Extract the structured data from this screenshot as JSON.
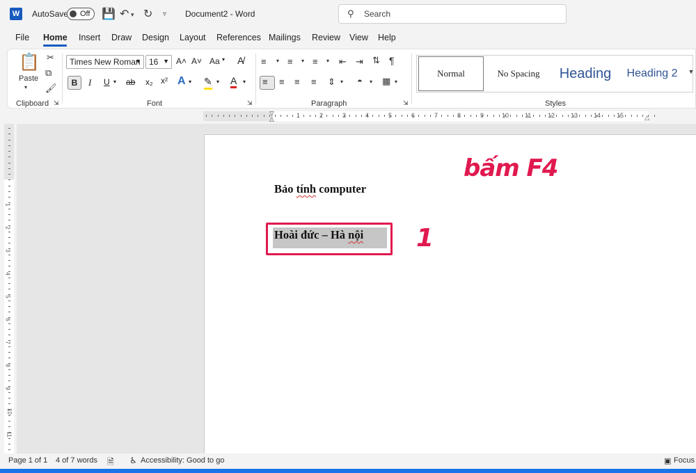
{
  "titlebar": {
    "logo": "W",
    "autosave_label": "AutoSave",
    "autosave_state": "Off",
    "document_title": "Document2 - Word",
    "search_placeholder": "Search"
  },
  "menu": {
    "tabs": [
      "File",
      "Home",
      "Insert",
      "Draw",
      "Design",
      "Layout",
      "References",
      "Mailings",
      "Review",
      "View",
      "Help"
    ],
    "active": "Home"
  },
  "ribbon": {
    "clipboard": {
      "paste_label": "Paste",
      "group_label": "Clipboard"
    },
    "font": {
      "family": "Times New Roman",
      "size": "16",
      "group_label": "Font",
      "grow": "A˄",
      "shrink": "A˅",
      "case": "Aa",
      "bold": "B",
      "italic": "I",
      "underline": "U",
      "strike": "ab",
      "subscript": "x₂",
      "superscript": "x²",
      "text_effects": "A",
      "highlight": "✎",
      "font_color": "A"
    },
    "paragraph": {
      "group_label": "Paragraph"
    },
    "styles": {
      "group_label": "Styles",
      "items": [
        "Normal",
        "No Spacing",
        "Heading",
        "Heading 2"
      ]
    }
  },
  "ruler": {
    "numbers": [
      "1",
      "2",
      "3",
      "4",
      "5",
      "6",
      "7",
      "8",
      "9",
      "10",
      "11",
      "12",
      "13",
      "14",
      "15"
    ]
  },
  "vruler": {
    "numbers": [
      "1",
      "2",
      "3",
      "4",
      "5",
      "6",
      "7",
      "8",
      "9",
      "10",
      "11"
    ]
  },
  "document": {
    "line1_a": "Bảo ",
    "line1_b": "tính",
    "line1_c": " computer",
    "line2_a": "Hoài đức – Hà ",
    "line2_b": "nội"
  },
  "annotations": {
    "step_text": "bấm F4",
    "step_number": "1"
  },
  "statusbar": {
    "page": "Page 1 of 1",
    "words": "4 of 7 words",
    "accessibility": "Accessibility: Good to go",
    "focus": "Focus"
  },
  "colors": {
    "brand": "#185abd",
    "annotation": "#e0194f",
    "heading": "#2f5496"
  }
}
